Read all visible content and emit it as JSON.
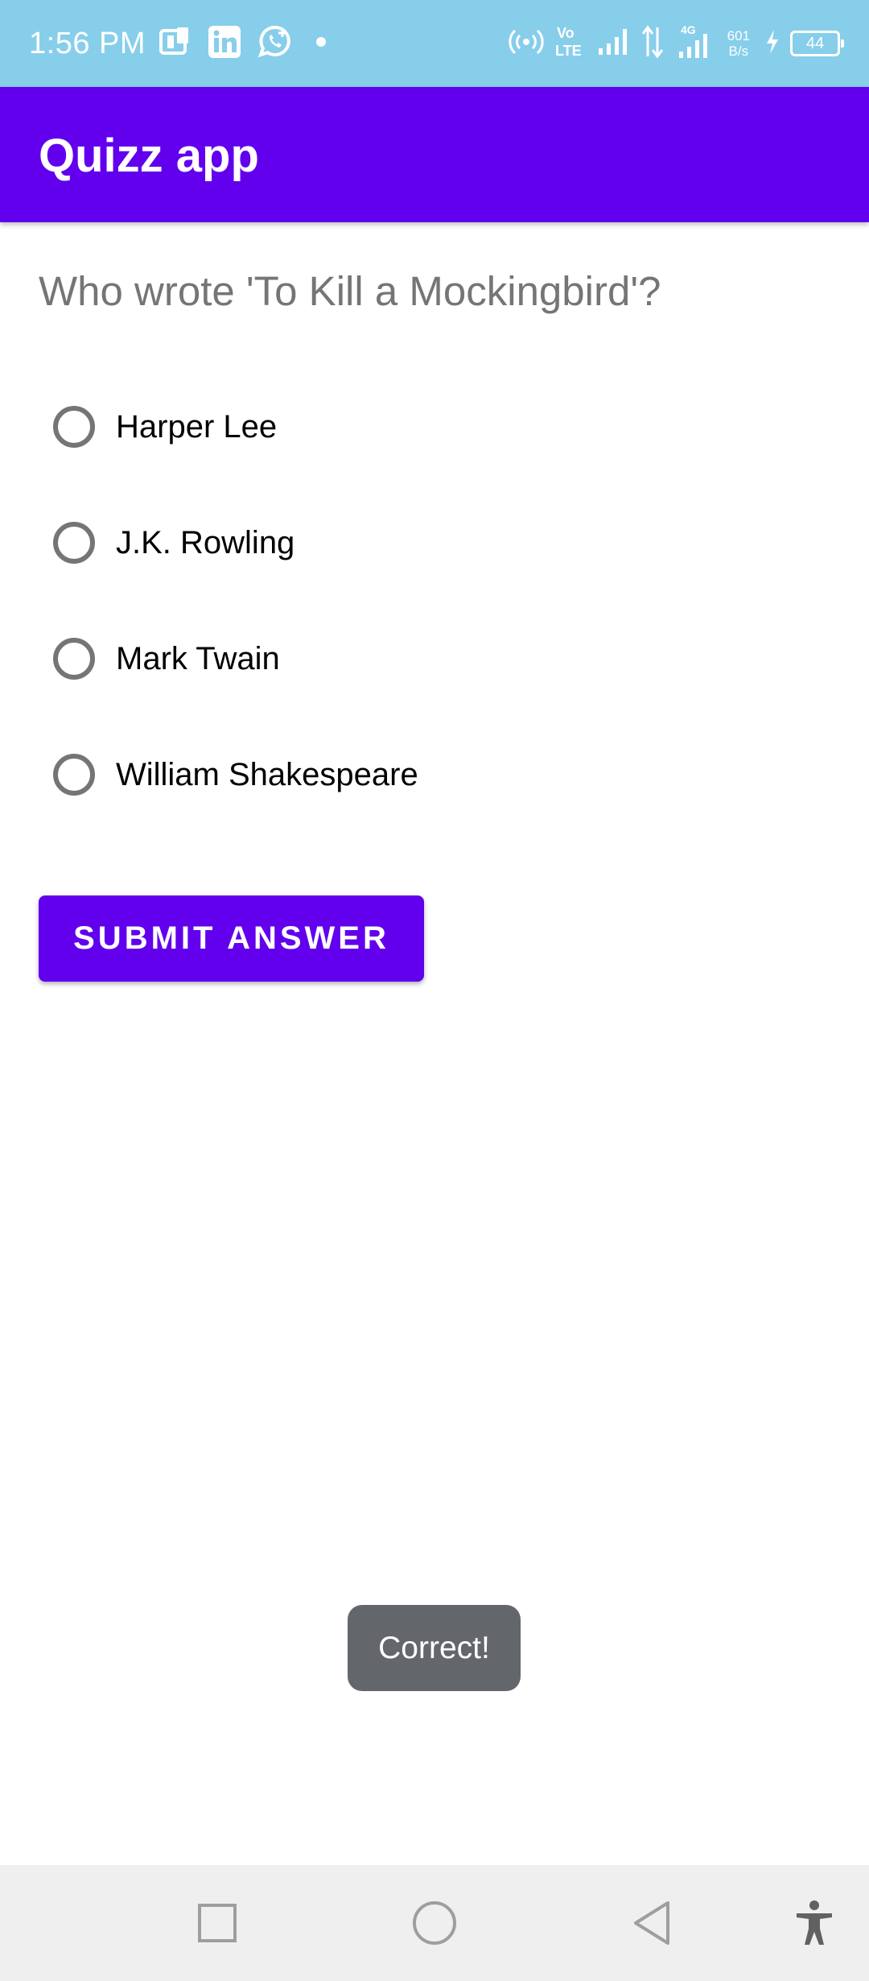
{
  "status_bar": {
    "time": "1:56 PM",
    "left_icons": [
      "paytm-icon",
      "linkedin-icon",
      "whatsapp-business-icon",
      "notification-dot-icon"
    ],
    "right_icons": [
      "hotspot-icon",
      "volte-icon",
      "signal-icon",
      "data-arrows-icon",
      "signal-4g-icon"
    ],
    "net_speed_value": "601",
    "net_speed_unit": "B/s",
    "battery_level": "44"
  },
  "app_bar": {
    "title": "Quizz app",
    "color": "#6200ee"
  },
  "quiz": {
    "question": "Who wrote 'To Kill a Mockingbird'?",
    "options": [
      {
        "label": "Harper Lee",
        "selected": false
      },
      {
        "label": "J.K. Rowling",
        "selected": false
      },
      {
        "label": "Mark Twain",
        "selected": false
      },
      {
        "label": "William Shakespeare",
        "selected": false
      }
    ],
    "submit_label": "SUBMIT ANSWER"
  },
  "toast": {
    "message": "Correct!"
  },
  "nav_bar": {
    "buttons": [
      "recents-icon",
      "home-icon",
      "back-icon",
      "accessibility-icon"
    ]
  }
}
